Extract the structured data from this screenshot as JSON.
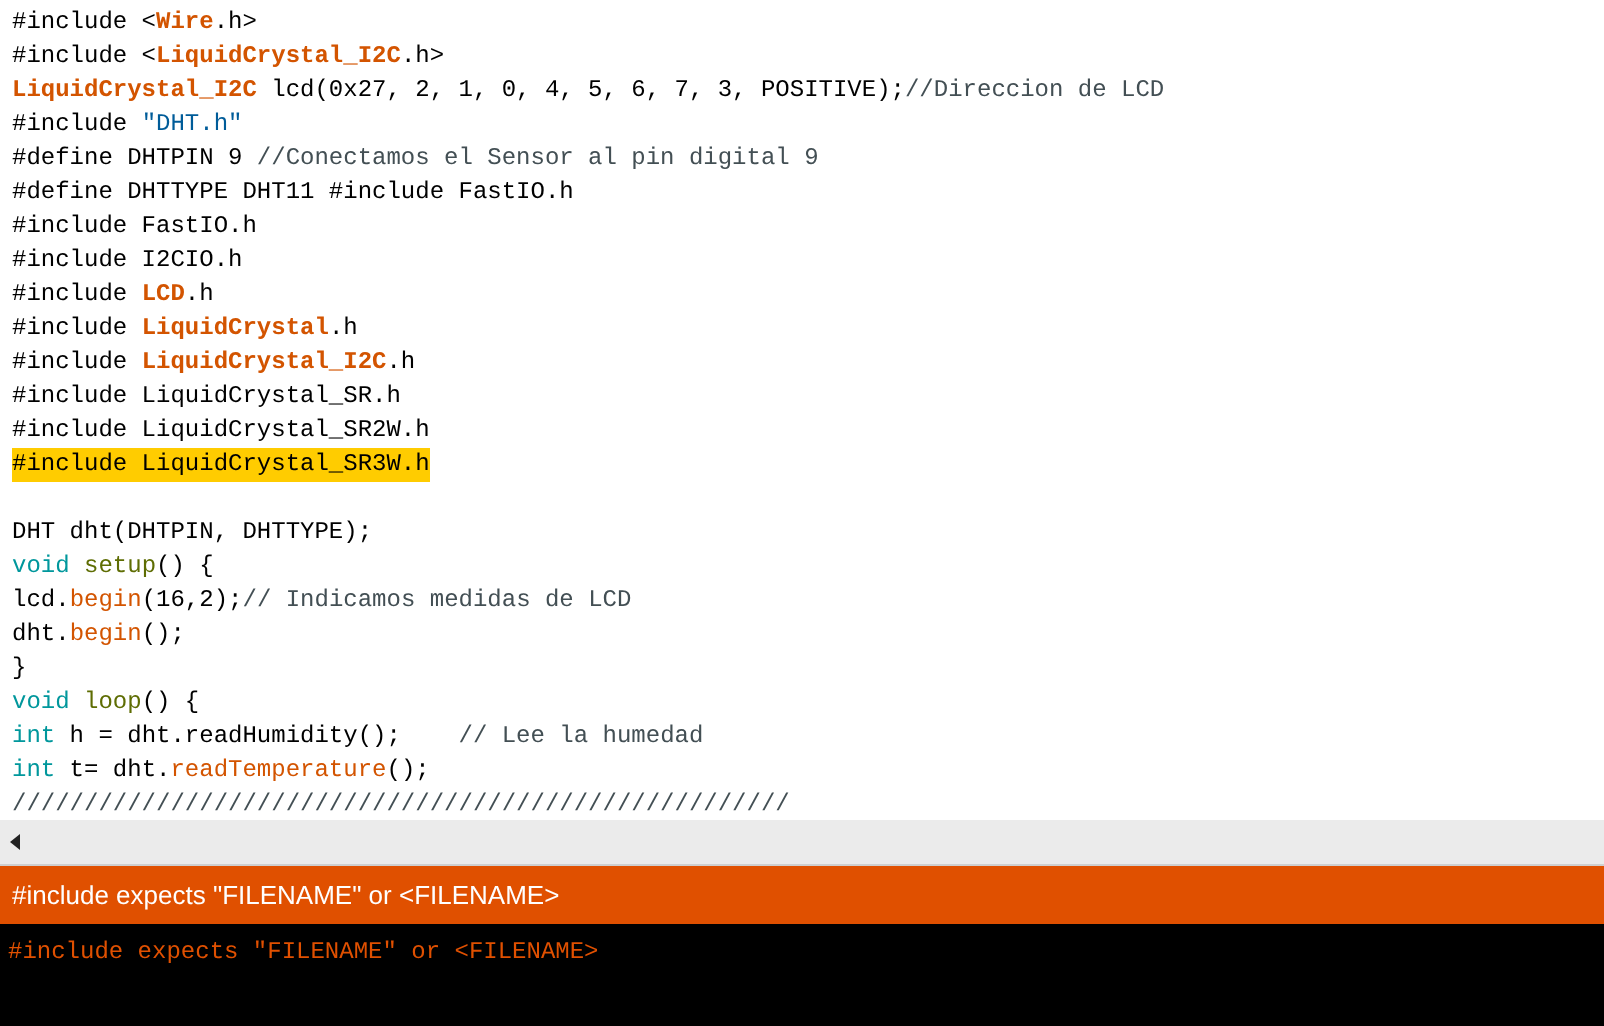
{
  "code_lines": [
    {
      "highlighted": false,
      "tokens": [
        {
          "kind": "plain",
          "text": "#include <"
        },
        {
          "kind": "library",
          "text": "Wire"
        },
        {
          "kind": "plain",
          "text": ".h>"
        }
      ]
    },
    {
      "highlighted": false,
      "tokens": [
        {
          "kind": "plain",
          "text": "#include <"
        },
        {
          "kind": "library",
          "text": "LiquidCrystal_I2C"
        },
        {
          "kind": "plain",
          "text": ".h>"
        }
      ]
    },
    {
      "highlighted": false,
      "tokens": [
        {
          "kind": "library",
          "text": "LiquidCrystal_I2C"
        },
        {
          "kind": "plain",
          "text": " lcd(0x27, 2, 1, 0, 4, 5, 6, 7, 3, POSITIVE);"
        },
        {
          "kind": "comment",
          "text": "//Direccion de LCD"
        }
      ]
    },
    {
      "highlighted": false,
      "tokens": [
        {
          "kind": "plain",
          "text": "#include "
        },
        {
          "kind": "string",
          "text": "\"DHT.h\""
        }
      ]
    },
    {
      "highlighted": false,
      "tokens": [
        {
          "kind": "plain",
          "text": "#define DHTPIN 9 "
        },
        {
          "kind": "comment",
          "text": "//Conectamos el Sensor al pin digital 9"
        }
      ]
    },
    {
      "highlighted": false,
      "tokens": [
        {
          "kind": "plain",
          "text": "#define DHTTYPE DHT11 #include FastIO.h"
        }
      ]
    },
    {
      "highlighted": false,
      "tokens": [
        {
          "kind": "plain",
          "text": "#include FastIO.h"
        }
      ]
    },
    {
      "highlighted": false,
      "tokens": [
        {
          "kind": "plain",
          "text": "#include I2CIO.h"
        }
      ]
    },
    {
      "highlighted": false,
      "tokens": [
        {
          "kind": "plain",
          "text": "#include "
        },
        {
          "kind": "library",
          "text": "LCD"
        },
        {
          "kind": "plain",
          "text": ".h"
        }
      ]
    },
    {
      "highlighted": false,
      "tokens": [
        {
          "kind": "plain",
          "text": "#include "
        },
        {
          "kind": "library",
          "text": "LiquidCrystal"
        },
        {
          "kind": "plain",
          "text": ".h"
        }
      ]
    },
    {
      "highlighted": false,
      "tokens": [
        {
          "kind": "plain",
          "text": "#include "
        },
        {
          "kind": "library",
          "text": "LiquidCrystal_I2C"
        },
        {
          "kind": "plain",
          "text": ".h"
        }
      ]
    },
    {
      "highlighted": false,
      "tokens": [
        {
          "kind": "plain",
          "text": "#include LiquidCrystal_SR.h"
        }
      ]
    },
    {
      "highlighted": false,
      "tokens": [
        {
          "kind": "plain",
          "text": "#include LiquidCrystal_SR2W.h"
        }
      ]
    },
    {
      "highlighted": true,
      "tokens": [
        {
          "kind": "plain",
          "text": "#include LiquidCrystal_SR3W.h"
        }
      ]
    },
    {
      "kind": "blank"
    },
    {
      "highlighted": false,
      "tokens": [
        {
          "kind": "plain",
          "text": "DHT dht(DHTPIN, DHTTYPE);"
        }
      ]
    },
    {
      "highlighted": false,
      "tokens": [
        {
          "kind": "keyword",
          "text": "void"
        },
        {
          "kind": "structure",
          "text": " setup"
        },
        {
          "kind": "plain",
          "text": "() {"
        }
      ]
    },
    {
      "highlighted": false,
      "tokens": [
        {
          "kind": "plain",
          "text": "lcd."
        },
        {
          "kind": "function",
          "text": "begin"
        },
        {
          "kind": "plain",
          "text": "(16,2);"
        },
        {
          "kind": "comment",
          "text": "// Indicamos medidas de LCD"
        }
      ]
    },
    {
      "highlighted": false,
      "tokens": [
        {
          "kind": "plain",
          "text": "dht."
        },
        {
          "kind": "function",
          "text": "begin"
        },
        {
          "kind": "plain",
          "text": "();"
        }
      ]
    },
    {
      "highlighted": false,
      "tokens": [
        {
          "kind": "plain",
          "text": "}"
        }
      ]
    },
    {
      "highlighted": false,
      "tokens": [
        {
          "kind": "keyword",
          "text": "void"
        },
        {
          "kind": "structure",
          "text": " loop"
        },
        {
          "kind": "plain",
          "text": "() {"
        }
      ]
    },
    {
      "highlighted": false,
      "tokens": [
        {
          "kind": "keyword",
          "text": "int"
        },
        {
          "kind": "plain",
          "text": " h = dht.readHumidity();    "
        },
        {
          "kind": "comment",
          "text": "// Lee la humedad"
        }
      ]
    },
    {
      "highlighted": false,
      "tokens": [
        {
          "kind": "keyword",
          "text": "int"
        },
        {
          "kind": "plain",
          "text": " t= dht."
        },
        {
          "kind": "function",
          "text": "readTemperature"
        },
        {
          "kind": "plain",
          "text": "();"
        }
      ]
    },
    {
      "highlighted": false,
      "tokens": [
        {
          "kind": "comment",
          "text": "//////////////////////////////////////////////////////"
        }
      ]
    }
  ],
  "status_bar": {
    "message": "#include expects \"FILENAME\" or <FILENAME>"
  },
  "console": {
    "lines": [
      "#include expects \"FILENAME\" or <FILENAME>"
    ]
  }
}
